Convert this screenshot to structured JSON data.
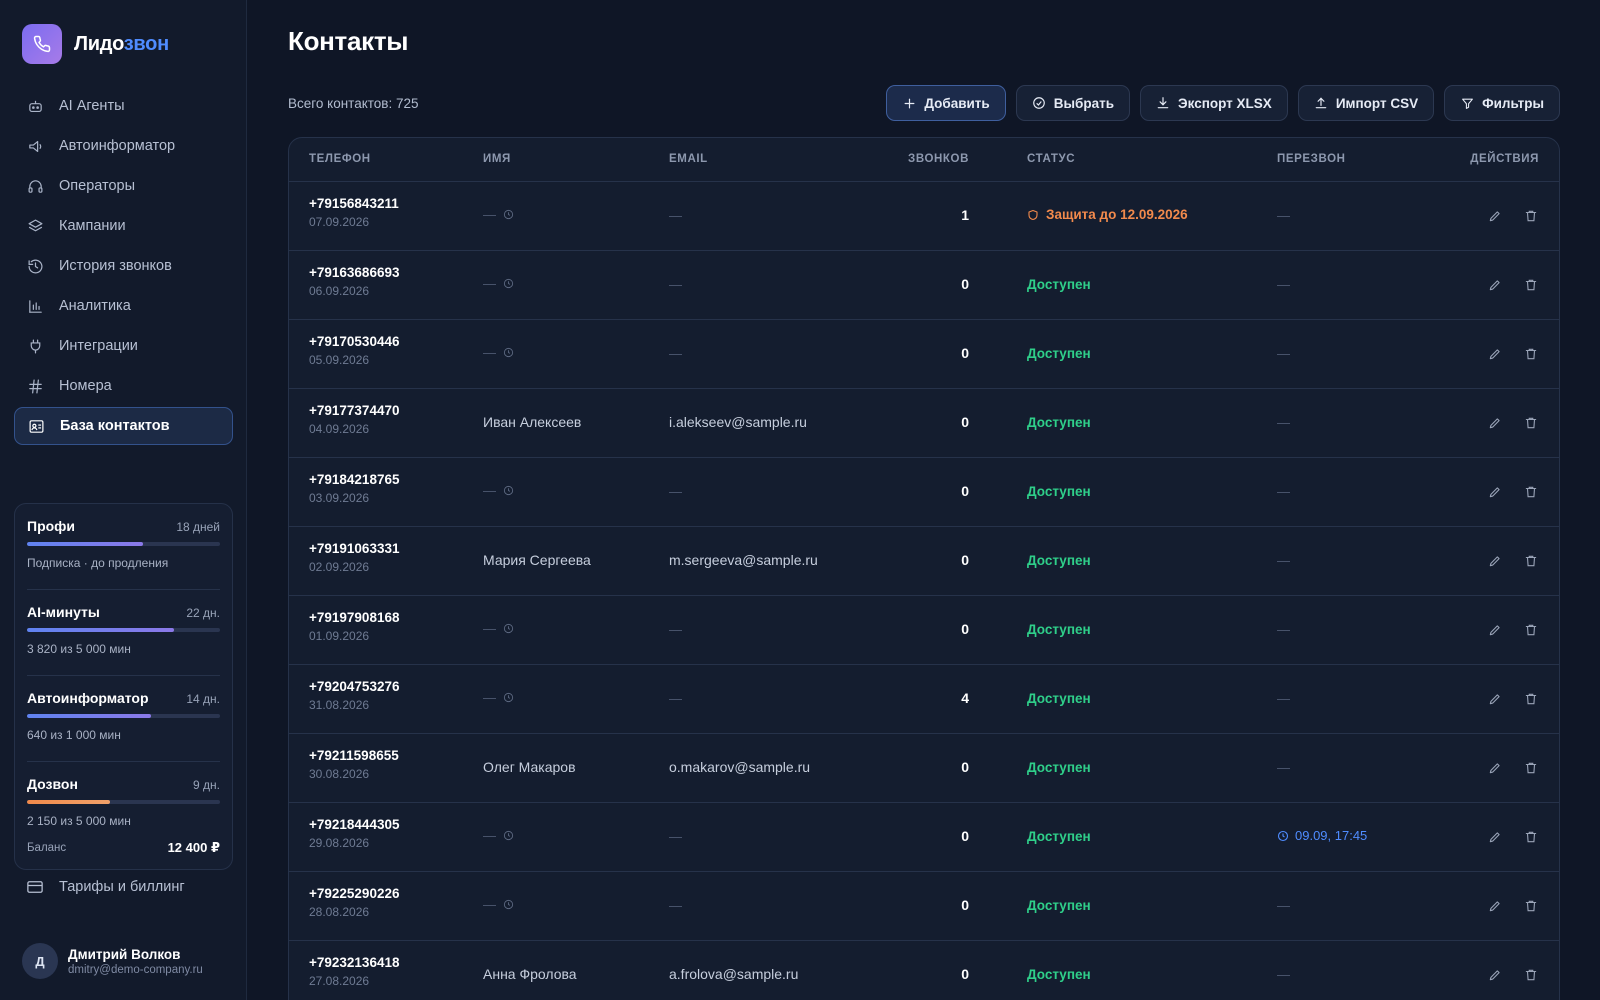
{
  "brand": {
    "name_part1": "Лидо",
    "name_part2": "звон",
    "logo_icon": "phone-icon"
  },
  "nav": [
    {
      "label": "AI Агенты",
      "icon": "robot-icon"
    },
    {
      "label": "Автоинформатор",
      "icon": "megaphone-icon"
    },
    {
      "label": "Операторы",
      "icon": "headset-icon"
    },
    {
      "label": "Кампании",
      "icon": "layers-icon"
    },
    {
      "label": "История звонков",
      "icon": "history-icon"
    },
    {
      "label": "Аналитика",
      "icon": "chart-icon"
    },
    {
      "label": "Интеграции",
      "icon": "plug-icon"
    },
    {
      "label": "Номера",
      "icon": "hash-icon"
    },
    {
      "label": "База контактов",
      "icon": "contact-card-icon",
      "active": true
    }
  ],
  "subscriptions": [
    {
      "title": "Профи",
      "days": "18 дней",
      "desc": "Подписка · до продления",
      "progress": 0.6,
      "color": "purple"
    },
    {
      "title": "AI-минуты",
      "days": "22 дн.",
      "desc": "3 820 из 5 000 мин",
      "progress": 0.76,
      "color": "purple"
    },
    {
      "title": "Автоинформатор",
      "days": "14 дн.",
      "desc": "640 из 1 000 мин",
      "progress": 0.64,
      "color": "purple"
    },
    {
      "title": "Дозвон",
      "days": "9 дн.",
      "desc": "2 150 из 5 000 мин",
      "progress": 0.43,
      "color": "orange"
    }
  ],
  "balance": {
    "label": "Баланс",
    "value": "12 400 ₽"
  },
  "billing": {
    "label": "Тарифы и биллинг",
    "icon": "card-icon"
  },
  "user": {
    "initial": "Д",
    "name": "Дмитрий Волков",
    "email": "dmitry@demo-company.ru"
  },
  "page": {
    "title": "Контакты",
    "total": "Всего контактов: 725"
  },
  "toolbar": {
    "add": "Добавить",
    "select": "Выбрать",
    "export": "Экспорт XLSX",
    "import": "Импорт CSV",
    "filters": "Фильтры"
  },
  "columns": {
    "phone": "Телефон",
    "name": "Имя",
    "email": "Email",
    "calls": "Звонков",
    "status": "Статус",
    "callback": "Перезвон",
    "actions": "Действия"
  },
  "rows": [
    {
      "phone": "+79156843211",
      "date": "07.09.2026",
      "name": "",
      "email": "",
      "calls": "1",
      "status": "Защита до 12.09.2026",
      "status_type": "protected",
      "callback": ""
    },
    {
      "phone": "+79163686693",
      "date": "06.09.2026",
      "name": "",
      "email": "",
      "calls": "0",
      "status": "Доступен",
      "status_type": "ok",
      "callback": ""
    },
    {
      "phone": "+79170530446",
      "date": "05.09.2026",
      "name": "",
      "email": "",
      "calls": "0",
      "status": "Доступен",
      "status_type": "ok",
      "callback": ""
    },
    {
      "phone": "+79177374470",
      "date": "04.09.2026",
      "name": "Иван Алексеев",
      "email": "i.alekseev@sample.ru",
      "calls": "0",
      "status": "Доступен",
      "status_type": "ok",
      "callback": ""
    },
    {
      "phone": "+79184218765",
      "date": "03.09.2026",
      "name": "",
      "email": "",
      "calls": "0",
      "status": "Доступен",
      "status_type": "ok",
      "callback": ""
    },
    {
      "phone": "+79191063331",
      "date": "02.09.2026",
      "name": "Мария Сергеева",
      "email": "m.sergeeva@sample.ru",
      "calls": "0",
      "status": "Доступен",
      "status_type": "ok",
      "callback": ""
    },
    {
      "phone": "+79197908168",
      "date": "01.09.2026",
      "name": "",
      "email": "",
      "calls": "0",
      "status": "Доступен",
      "status_type": "ok",
      "callback": ""
    },
    {
      "phone": "+79204753276",
      "date": "31.08.2026",
      "name": "",
      "email": "",
      "calls": "4",
      "status": "Доступен",
      "status_type": "ok",
      "callback": ""
    },
    {
      "phone": "+79211598655",
      "date": "30.08.2026",
      "name": "Олег Макаров",
      "email": "o.makarov@sample.ru",
      "calls": "0",
      "status": "Доступен",
      "status_type": "ok",
      "callback": ""
    },
    {
      "phone": "+79218444305",
      "date": "29.08.2026",
      "name": "",
      "email": "",
      "calls": "0",
      "status": "Доступен",
      "status_type": "ok",
      "callback": "09.09, 17:45"
    },
    {
      "phone": "+79225290226",
      "date": "28.08.2026",
      "name": "",
      "email": "",
      "calls": "0",
      "status": "Доступен",
      "status_type": "ok",
      "callback": ""
    },
    {
      "phone": "+79232136418",
      "date": "27.08.2026",
      "name": "Анна Фролова",
      "email": "a.frolova@sample.ru",
      "calls": "0",
      "status": "Доступен",
      "status_type": "ok",
      "callback": ""
    }
  ],
  "empty_placeholder": "—",
  "colors": {
    "accent": "#4f8cff",
    "ok": "#2fcf8a",
    "warning": "#f28a4c",
    "bg": "#0f1626"
  }
}
